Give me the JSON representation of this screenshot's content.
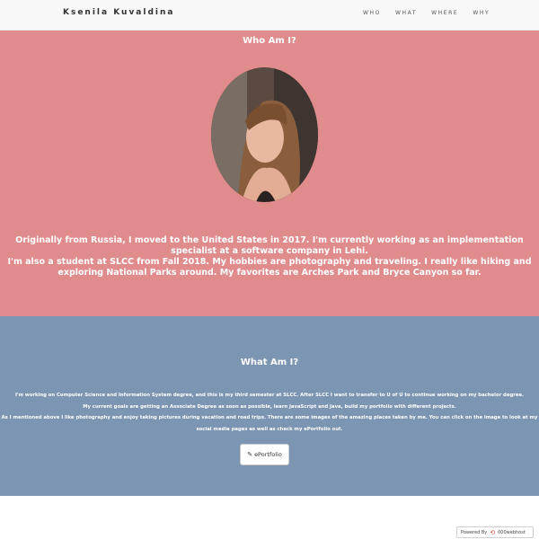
{
  "navbar": {
    "brand": "Ksenila Kuvaldina",
    "links": [
      "WHO",
      "WHAT",
      "WHERE",
      "WHY"
    ]
  },
  "who": {
    "title": "Who Am I?",
    "lines": [
      "Originally from Russia, I moved to the United States in 2017. I'm currently working as an implementation specialist at a software company in Lehi.",
      "I'm also a student at SLCC from Fall 2018. My hobbies are photography and traveling. I really like hiking and exploring National Parks around. My favorites are Arches Park and Bryce Canyon so far."
    ]
  },
  "what": {
    "title": "What Am I?",
    "lines": [
      "I'm working on Computer Science and Information System degree, and this is my third semester at SLCC. After SLCC I want to transfer to U of U to continue working on my bachelor degree.",
      "My current goals are getting an Associate Degree as soon as possible, learn JavaScript and Java, build my portfolio with different projects.",
      "As I mentioned above I like photography and enjoy taking pictures during vacation and road trips. There are some images of the amazing places taken by me. You can click on the image to look at my social media pages as well as check my ePortfolio out."
    ],
    "button_label": "ePortfolio",
    "button_icon": "pencil-icon"
  },
  "footer": {
    "powered_by": "Powered By",
    "host": "000webhost"
  },
  "colors": {
    "who_bg": "#e08c8c",
    "what_bg": "#7b95b3"
  }
}
